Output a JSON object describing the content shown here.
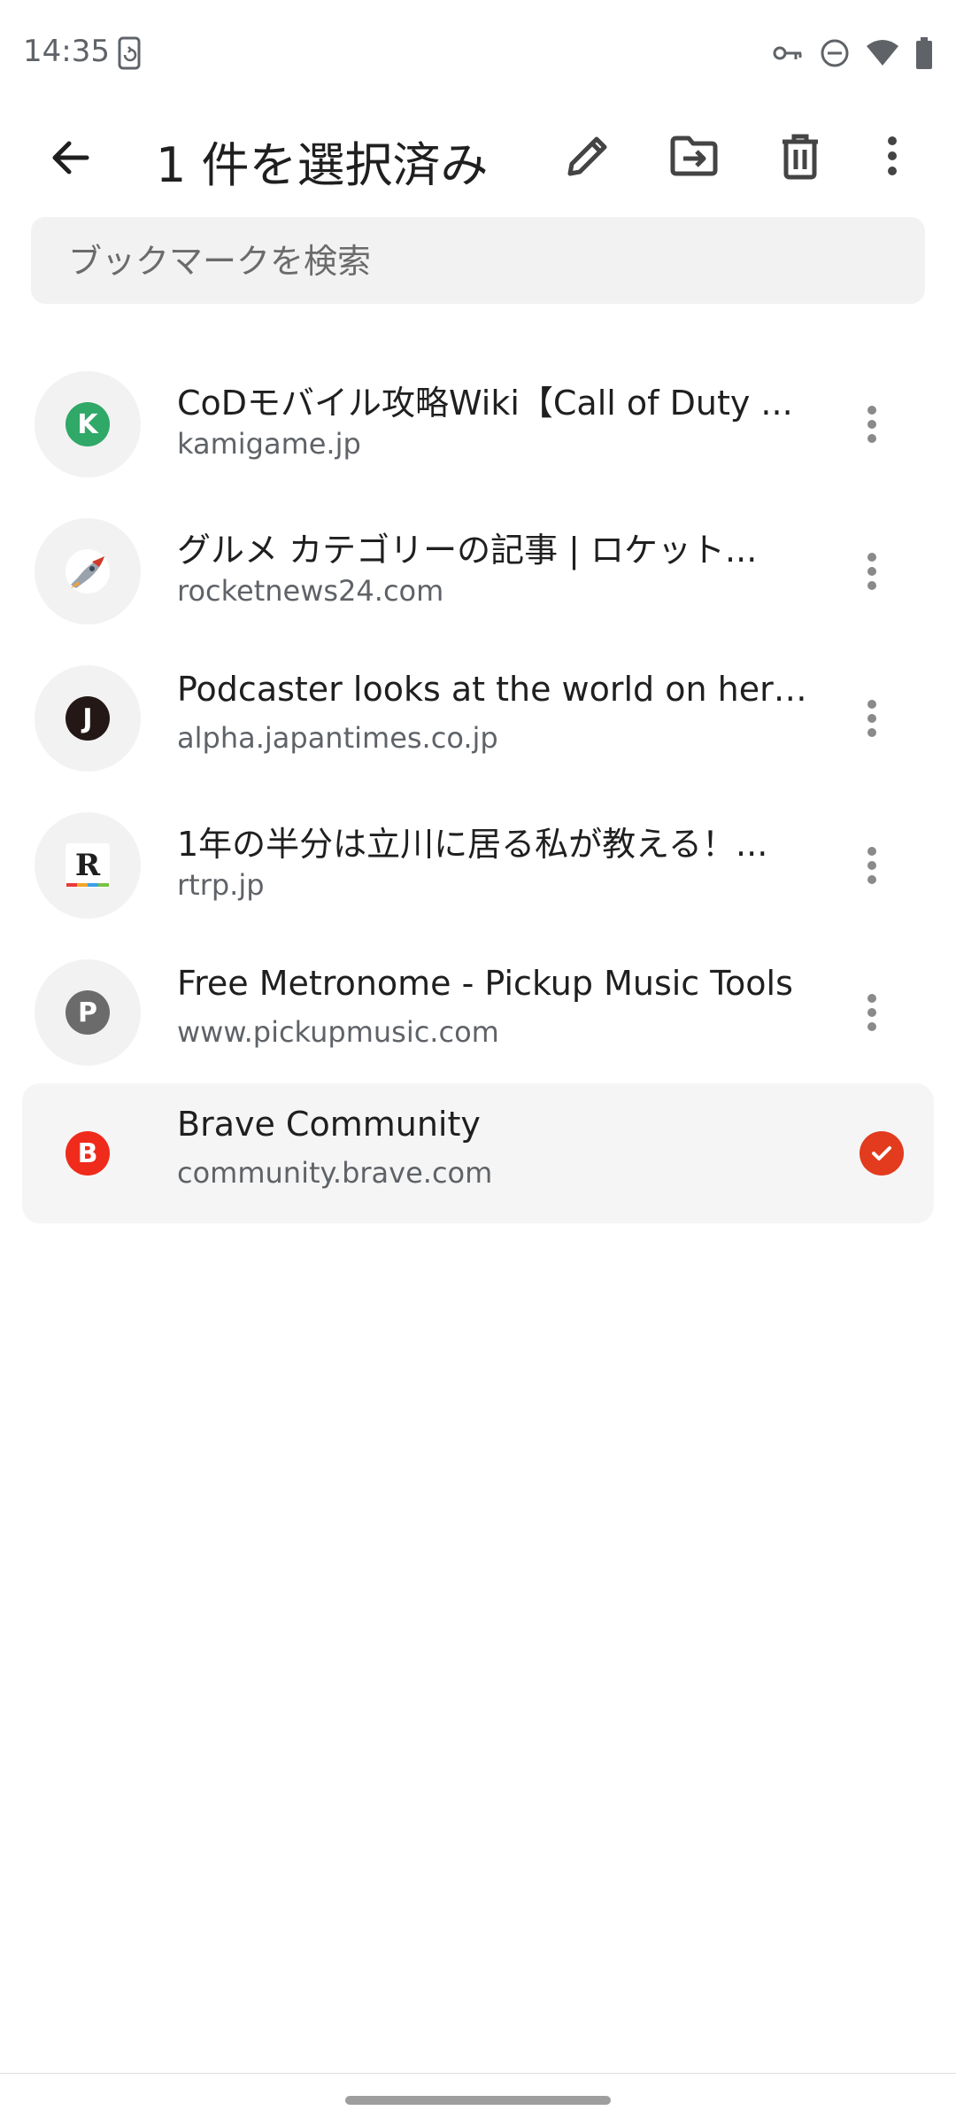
{
  "status_bar": {
    "time": "14:35"
  },
  "app_bar": {
    "title": "1 件を選択済み"
  },
  "search": {
    "placeholder": "ブックマークを検索"
  },
  "colors": {
    "accent": "#e23b1e",
    "brave_red": "#ef2b1b"
  },
  "bookmarks": [
    {
      "title": "CoDモバイル攻略Wiki【Call of Duty ...",
      "url": "kamigame.jp",
      "favicon_letter": "K",
      "favicon_color": "#2fa868",
      "selected": false
    },
    {
      "title": "グルメ カテゴリーの記事 | ロケット...",
      "url": "rocketnews24.com",
      "favicon_letter": "",
      "favicon_color": "#ffffff",
      "favicon_icon": "rocket-icon",
      "selected": false
    },
    {
      "title": "Podcaster looks at the world on her ...",
      "url": "alpha.japantimes.co.jp",
      "favicon_letter": "J",
      "favicon_color": "#231815",
      "selected": false
    },
    {
      "title": "1年の半分は立川に居る私が教える！...",
      "url": "rtrp.jp",
      "favicon_letter": "R",
      "favicon_color": "#ffffff",
      "selected": false
    },
    {
      "title": "Free Metronome - Pickup Music Tools",
      "url": "www.pickupmusic.com",
      "favicon_letter": "P",
      "favicon_color": "#6b6b6b",
      "selected": false
    },
    {
      "title": "Brave Community",
      "url": "community.brave.com",
      "favicon_letter": "B",
      "favicon_color": "#ef2b1b",
      "selected": true
    }
  ]
}
